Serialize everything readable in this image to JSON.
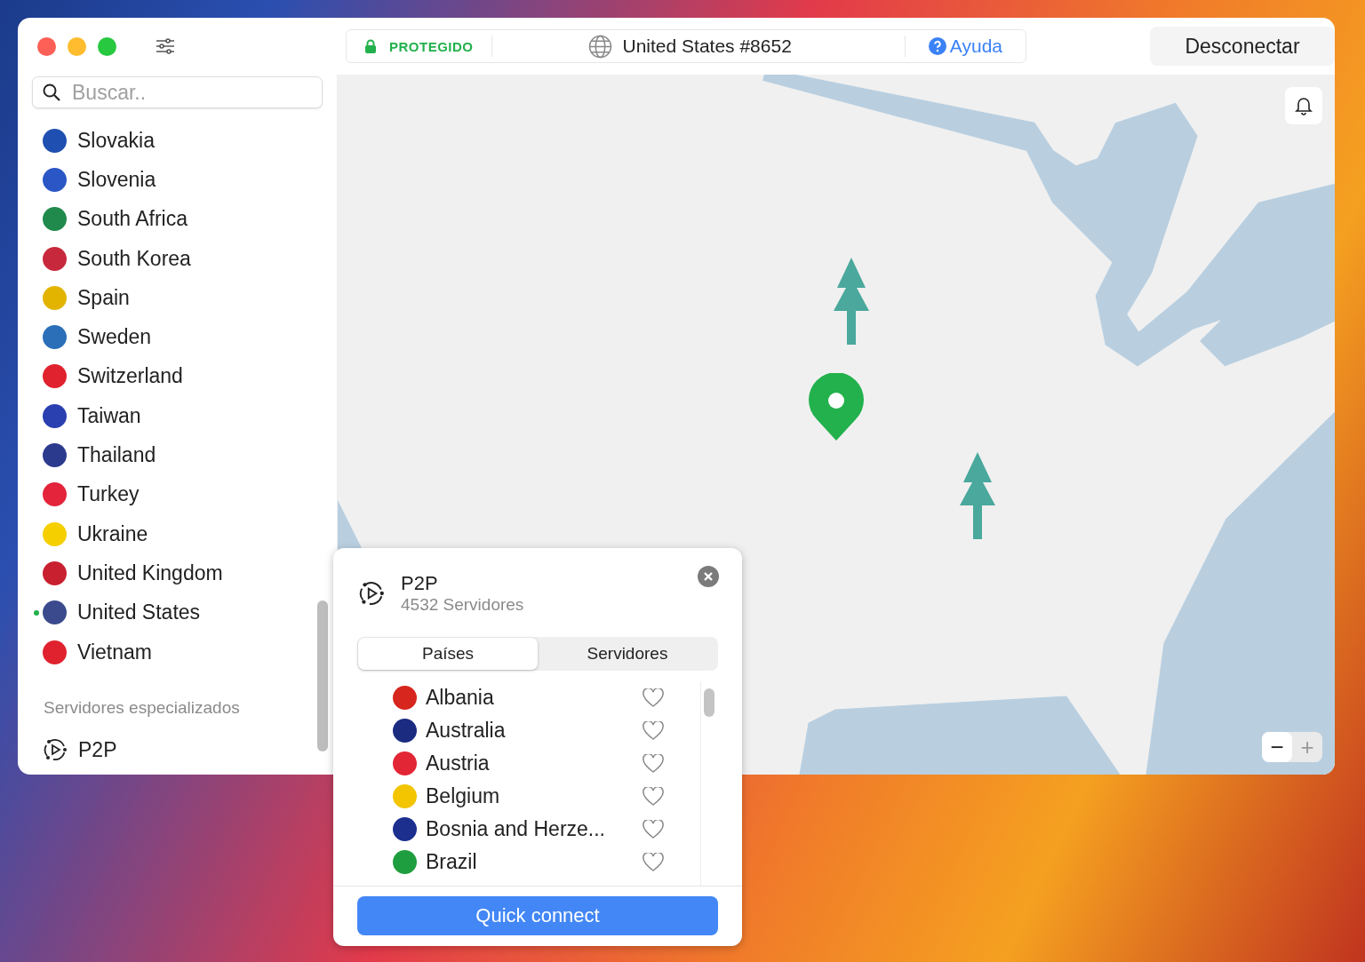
{
  "toolbar": {
    "status": "PROTEGIDO",
    "server": "United States #8652",
    "help": "Ayuda",
    "disconnect": "Desconectar"
  },
  "sidebar": {
    "search": {
      "placeholder": "Buscar.."
    },
    "countries": [
      {
        "name": "Slovakia",
        "color": "#1f4fb0",
        "connected": false
      },
      {
        "name": "Slovenia",
        "color": "#2a56c6",
        "connected": false
      },
      {
        "name": "South Africa",
        "color": "#1f8a4c",
        "connected": false
      },
      {
        "name": "South Korea",
        "color": "#c8283c",
        "connected": false
      },
      {
        "name": "Spain",
        "color": "#e2b400",
        "connected": false
      },
      {
        "name": "Sweden",
        "color": "#2a6fb8",
        "connected": false
      },
      {
        "name": "Switzerland",
        "color": "#e0222e",
        "connected": false
      },
      {
        "name": "Taiwan",
        "color": "#2a3fb0",
        "connected": false
      },
      {
        "name": "Thailand",
        "color": "#2c3a8e",
        "connected": false
      },
      {
        "name": "Turkey",
        "color": "#e3243b",
        "connected": false
      },
      {
        "name": "Ukraine",
        "color": "#f5cf00",
        "connected": false
      },
      {
        "name": "United Kingdom",
        "color": "#c8202f",
        "connected": false
      },
      {
        "name": "United States",
        "color": "#3a4a8c",
        "connected": true
      },
      {
        "name": "Vietnam",
        "color": "#e0222e",
        "connected": false
      }
    ],
    "section": "Servidores especializados",
    "special": [
      {
        "name": "P2P"
      }
    ]
  },
  "map": {
    "zoom_out": "−",
    "zoom_in": "+"
  },
  "popover": {
    "title": "P2P",
    "subtitle": "4532 Servidores",
    "tabs": [
      {
        "label": "Países",
        "selected": true
      },
      {
        "label": "Servidores",
        "selected": false
      }
    ],
    "countries": [
      {
        "name": "Albania",
        "color": "#d7261e",
        "favorite": false
      },
      {
        "name": "Australia",
        "color": "#1a2b80",
        "favorite": false
      },
      {
        "name": "Austria",
        "color": "#e32636",
        "favorite": false
      },
      {
        "name": "Belgium",
        "color": "#f2c500",
        "favorite": false
      },
      {
        "name": "Bosnia and Herze...",
        "color": "#1c2f8f",
        "favorite": false
      },
      {
        "name": "Brazil",
        "color": "#1f9e3f",
        "favorite": false
      }
    ],
    "action": "Quick connect"
  }
}
